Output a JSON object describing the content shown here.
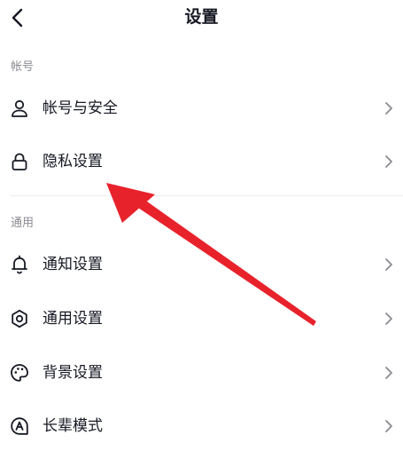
{
  "header": {
    "title": "设置",
    "back_icon": "chevron-left-icon"
  },
  "sections": [
    {
      "title": "帐号",
      "items": [
        {
          "label": "帐号与安全",
          "icon": "user-icon"
        },
        {
          "label": "隐私设置",
          "icon": "lock-icon"
        }
      ]
    },
    {
      "title": "通用",
      "items": [
        {
          "label": "通知设置",
          "icon": "bell-icon"
        },
        {
          "label": "通用设置",
          "icon": "gear-icon"
        },
        {
          "label": "背景设置",
          "icon": "palette-icon"
        },
        {
          "label": "长辈模式",
          "icon": "elder-mode-icon"
        }
      ]
    }
  ],
  "colors": {
    "text": "#161823",
    "secondary_text": "#8a8b91",
    "divider": "#ececee",
    "annotation_arrow": "#e8222b"
  }
}
